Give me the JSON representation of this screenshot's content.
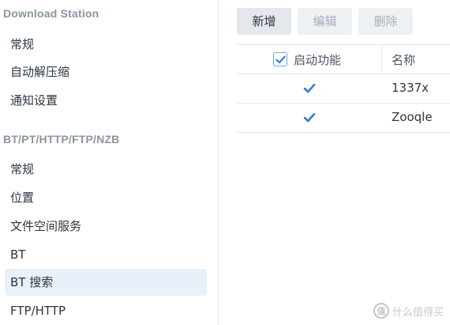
{
  "sidebar": {
    "section1_title": "Download Station",
    "section1_items": [
      {
        "label": "常规"
      },
      {
        "label": "自动解压缩"
      },
      {
        "label": "通知设置"
      }
    ],
    "section2_title": "BT/PT/HTTP/FTP/NZB",
    "section2_items": [
      {
        "label": "常规"
      },
      {
        "label": "位置"
      },
      {
        "label": "文件空间服务"
      },
      {
        "label": "BT"
      },
      {
        "label": "BT 搜索",
        "active": true
      },
      {
        "label": "FTP/HTTP"
      }
    ]
  },
  "toolbar": {
    "add_label": "新增",
    "edit_label": "编辑",
    "delete_label": "删除"
  },
  "table": {
    "headers": {
      "enable": "启动功能",
      "name": "名称"
    },
    "rows": [
      {
        "enabled": true,
        "name": "1337x"
      },
      {
        "enabled": true,
        "name": "Zooqle"
      }
    ]
  },
  "watermark": {
    "logo_text": "值",
    "text": "什么值得买"
  },
  "colors": {
    "accent": "#2f7fd7",
    "active_bg": "#e8f1fa",
    "section_title": "#8a95a1"
  },
  "icons": {
    "checkbox": "checkmark-icon"
  }
}
